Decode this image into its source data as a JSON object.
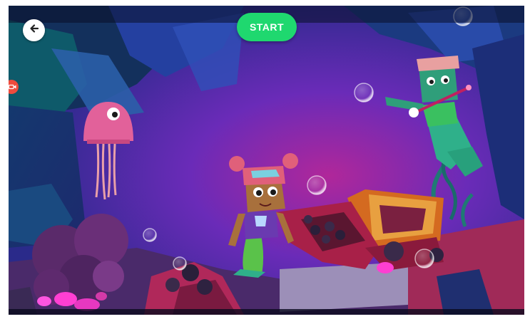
{
  "toolbar": {
    "back_icon": "arrow-left-icon",
    "start_label": "START",
    "start_color": "#1fd86f",
    "record_icon": "video-camera-icon",
    "record_color": "#ef4b3d"
  },
  "scene": {
    "theme": "underwater-cave",
    "characters": [
      "pink-jellyfish",
      "mermaid-girl",
      "green-merman-with-staff"
    ],
    "props": [
      "treasure-chest",
      "purple-coral",
      "bubbles"
    ]
  }
}
